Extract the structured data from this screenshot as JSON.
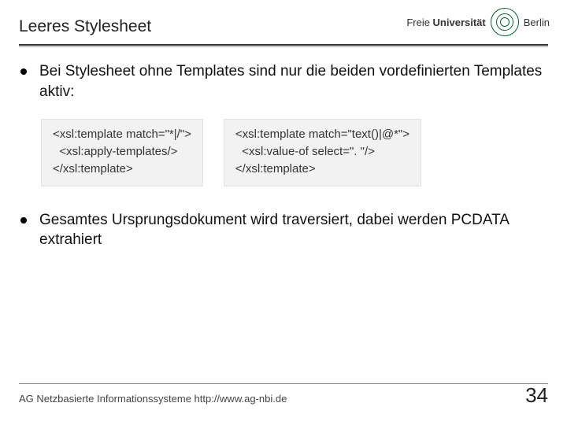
{
  "header": {
    "title": "Leeres Stylesheet",
    "logo_light": "Freie ",
    "logo_bold": "Universität",
    "logo_city": "Berlin"
  },
  "bullets": {
    "b1": "Bei Stylesheet ohne Templates sind nur die beiden vordefinierten Templates aktiv:",
    "b2": "Gesamtes Ursprungsdokument wird traversiert, dabei werden PCDATA extrahiert"
  },
  "code": {
    "left": "<xsl:template match=\"*|/\">\n  <xsl:apply-templates/>\n</xsl:template>",
    "right": "<xsl:template match=\"text()|@*\">\n  <xsl:value-of select=\". \"/>\n</xsl:template>"
  },
  "footer": {
    "text": "AG Netzbasierte Informationssysteme http://www.ag-nbi.de",
    "page": "34"
  }
}
